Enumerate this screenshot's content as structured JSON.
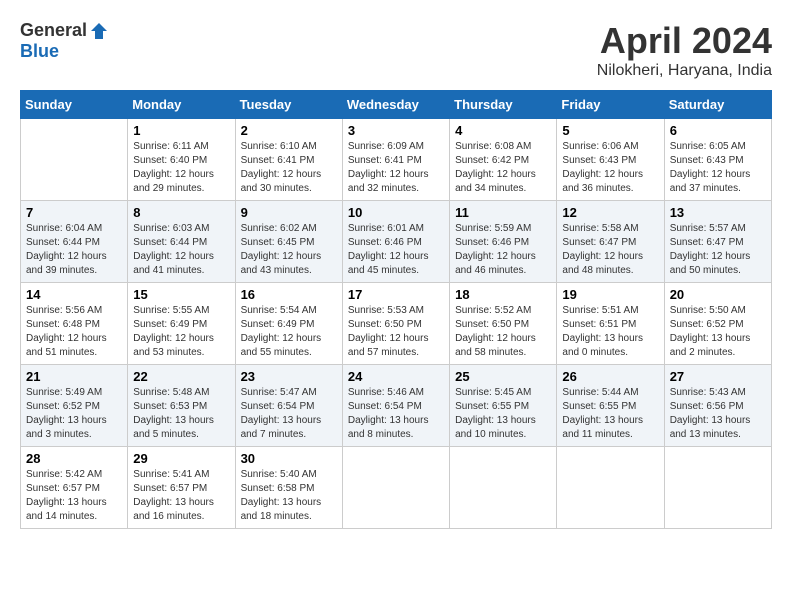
{
  "header": {
    "logo_general": "General",
    "logo_blue": "Blue",
    "title": "April 2024",
    "location": "Nilokheri, Haryana, India"
  },
  "days_of_week": [
    "Sunday",
    "Monday",
    "Tuesday",
    "Wednesday",
    "Thursday",
    "Friday",
    "Saturday"
  ],
  "weeks": [
    [
      {
        "num": "",
        "info": ""
      },
      {
        "num": "1",
        "info": "Sunrise: 6:11 AM\nSunset: 6:40 PM\nDaylight: 12 hours\nand 29 minutes."
      },
      {
        "num": "2",
        "info": "Sunrise: 6:10 AM\nSunset: 6:41 PM\nDaylight: 12 hours\nand 30 minutes."
      },
      {
        "num": "3",
        "info": "Sunrise: 6:09 AM\nSunset: 6:41 PM\nDaylight: 12 hours\nand 32 minutes."
      },
      {
        "num": "4",
        "info": "Sunrise: 6:08 AM\nSunset: 6:42 PM\nDaylight: 12 hours\nand 34 minutes."
      },
      {
        "num": "5",
        "info": "Sunrise: 6:06 AM\nSunset: 6:43 PM\nDaylight: 12 hours\nand 36 minutes."
      },
      {
        "num": "6",
        "info": "Sunrise: 6:05 AM\nSunset: 6:43 PM\nDaylight: 12 hours\nand 37 minutes."
      }
    ],
    [
      {
        "num": "7",
        "info": "Sunrise: 6:04 AM\nSunset: 6:44 PM\nDaylight: 12 hours\nand 39 minutes."
      },
      {
        "num": "8",
        "info": "Sunrise: 6:03 AM\nSunset: 6:44 PM\nDaylight: 12 hours\nand 41 minutes."
      },
      {
        "num": "9",
        "info": "Sunrise: 6:02 AM\nSunset: 6:45 PM\nDaylight: 12 hours\nand 43 minutes."
      },
      {
        "num": "10",
        "info": "Sunrise: 6:01 AM\nSunset: 6:46 PM\nDaylight: 12 hours\nand 45 minutes."
      },
      {
        "num": "11",
        "info": "Sunrise: 5:59 AM\nSunset: 6:46 PM\nDaylight: 12 hours\nand 46 minutes."
      },
      {
        "num": "12",
        "info": "Sunrise: 5:58 AM\nSunset: 6:47 PM\nDaylight: 12 hours\nand 48 minutes."
      },
      {
        "num": "13",
        "info": "Sunrise: 5:57 AM\nSunset: 6:47 PM\nDaylight: 12 hours\nand 50 minutes."
      }
    ],
    [
      {
        "num": "14",
        "info": "Sunrise: 5:56 AM\nSunset: 6:48 PM\nDaylight: 12 hours\nand 51 minutes."
      },
      {
        "num": "15",
        "info": "Sunrise: 5:55 AM\nSunset: 6:49 PM\nDaylight: 12 hours\nand 53 minutes."
      },
      {
        "num": "16",
        "info": "Sunrise: 5:54 AM\nSunset: 6:49 PM\nDaylight: 12 hours\nand 55 minutes."
      },
      {
        "num": "17",
        "info": "Sunrise: 5:53 AM\nSunset: 6:50 PM\nDaylight: 12 hours\nand 57 minutes."
      },
      {
        "num": "18",
        "info": "Sunrise: 5:52 AM\nSunset: 6:50 PM\nDaylight: 12 hours\nand 58 minutes."
      },
      {
        "num": "19",
        "info": "Sunrise: 5:51 AM\nSunset: 6:51 PM\nDaylight: 13 hours\nand 0 minutes."
      },
      {
        "num": "20",
        "info": "Sunrise: 5:50 AM\nSunset: 6:52 PM\nDaylight: 13 hours\nand 2 minutes."
      }
    ],
    [
      {
        "num": "21",
        "info": "Sunrise: 5:49 AM\nSunset: 6:52 PM\nDaylight: 13 hours\nand 3 minutes."
      },
      {
        "num": "22",
        "info": "Sunrise: 5:48 AM\nSunset: 6:53 PM\nDaylight: 13 hours\nand 5 minutes."
      },
      {
        "num": "23",
        "info": "Sunrise: 5:47 AM\nSunset: 6:54 PM\nDaylight: 13 hours\nand 7 minutes."
      },
      {
        "num": "24",
        "info": "Sunrise: 5:46 AM\nSunset: 6:54 PM\nDaylight: 13 hours\nand 8 minutes."
      },
      {
        "num": "25",
        "info": "Sunrise: 5:45 AM\nSunset: 6:55 PM\nDaylight: 13 hours\nand 10 minutes."
      },
      {
        "num": "26",
        "info": "Sunrise: 5:44 AM\nSunset: 6:55 PM\nDaylight: 13 hours\nand 11 minutes."
      },
      {
        "num": "27",
        "info": "Sunrise: 5:43 AM\nSunset: 6:56 PM\nDaylight: 13 hours\nand 13 minutes."
      }
    ],
    [
      {
        "num": "28",
        "info": "Sunrise: 5:42 AM\nSunset: 6:57 PM\nDaylight: 13 hours\nand 14 minutes."
      },
      {
        "num": "29",
        "info": "Sunrise: 5:41 AM\nSunset: 6:57 PM\nDaylight: 13 hours\nand 16 minutes."
      },
      {
        "num": "30",
        "info": "Sunrise: 5:40 AM\nSunset: 6:58 PM\nDaylight: 13 hours\nand 18 minutes."
      },
      {
        "num": "",
        "info": ""
      },
      {
        "num": "",
        "info": ""
      },
      {
        "num": "",
        "info": ""
      },
      {
        "num": "",
        "info": ""
      }
    ]
  ]
}
